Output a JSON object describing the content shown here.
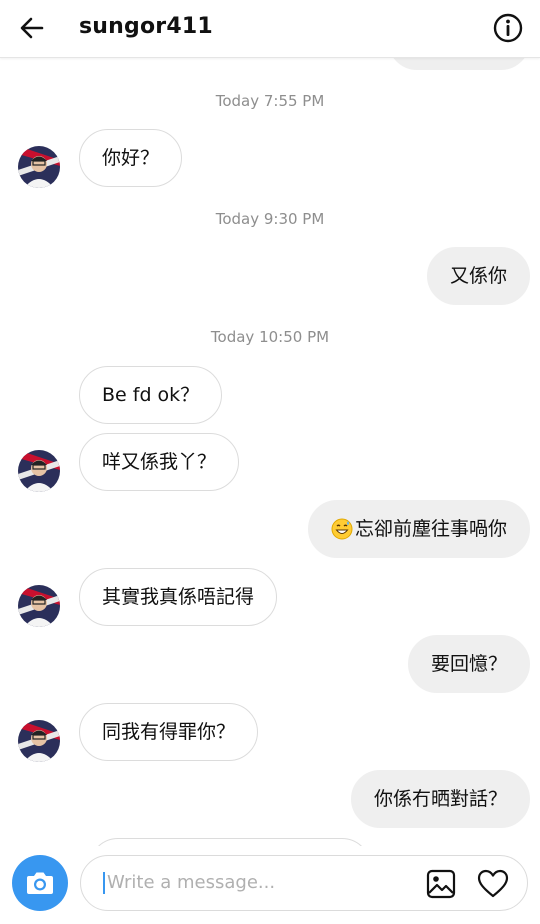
{
  "header": {
    "title": "sungor411"
  },
  "messages": {
    "ts1": "Today 7:55 PM",
    "ts2": "Today 9:30 PM",
    "ts3": "Today 10:50 PM",
    "m1": "你好？",
    "m2": "又係你",
    "m3": "Be fd ok？",
    "m4": "咩又係我丫？",
    "m5": "忘卻前塵往事喎你",
    "m6": "其實我真係唔記得",
    "m7": "要回憶？",
    "m8": "同我有得罪你？",
    "m9": "你係冇晒對話？"
  },
  "composer": {
    "placeholder": "Write a message..."
  },
  "icons": {
    "back": "arrow-left-icon",
    "info": "info-icon",
    "camera": "camera-icon",
    "gallery": "image-icon",
    "like": "heart-icon",
    "emoji": "grinning-sweat-emoji"
  },
  "colors": {
    "accent": "#3897f0",
    "outgoing_bubble": "#efefef",
    "timestamp": "#8e8e8e"
  }
}
